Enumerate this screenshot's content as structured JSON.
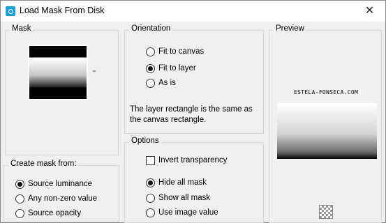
{
  "window": {
    "title": "Load Mask From Disk",
    "close_glyph": "✕"
  },
  "mask": {
    "legend": "Mask"
  },
  "create_mask": {
    "legend": "Create mask from:",
    "options": [
      {
        "label": "Source luminance",
        "checked": true
      },
      {
        "label": "Any non-zero value",
        "checked": false
      },
      {
        "label": "Source opacity",
        "checked": false
      }
    ]
  },
  "orientation": {
    "legend": "Orientation",
    "options": [
      {
        "label": "Fit to canvas",
        "checked": false
      },
      {
        "label": "Fit to layer",
        "checked": true
      },
      {
        "label": "As is",
        "checked": false
      }
    ],
    "description": "The layer rectangle is the same as the canvas rectangle."
  },
  "options": {
    "legend": "Options",
    "invert_label": "Invert transparency",
    "invert_checked": false,
    "radios": [
      {
        "label": "Hide all mask",
        "checked": true
      },
      {
        "label": "Show all mask",
        "checked": false
      },
      {
        "label": "Use image value",
        "checked": false
      }
    ]
  },
  "preview": {
    "legend": "Preview",
    "watermark": "ESTELA-FONSECA.COM"
  },
  "colors": {
    "accent": "#1aa0d0"
  }
}
